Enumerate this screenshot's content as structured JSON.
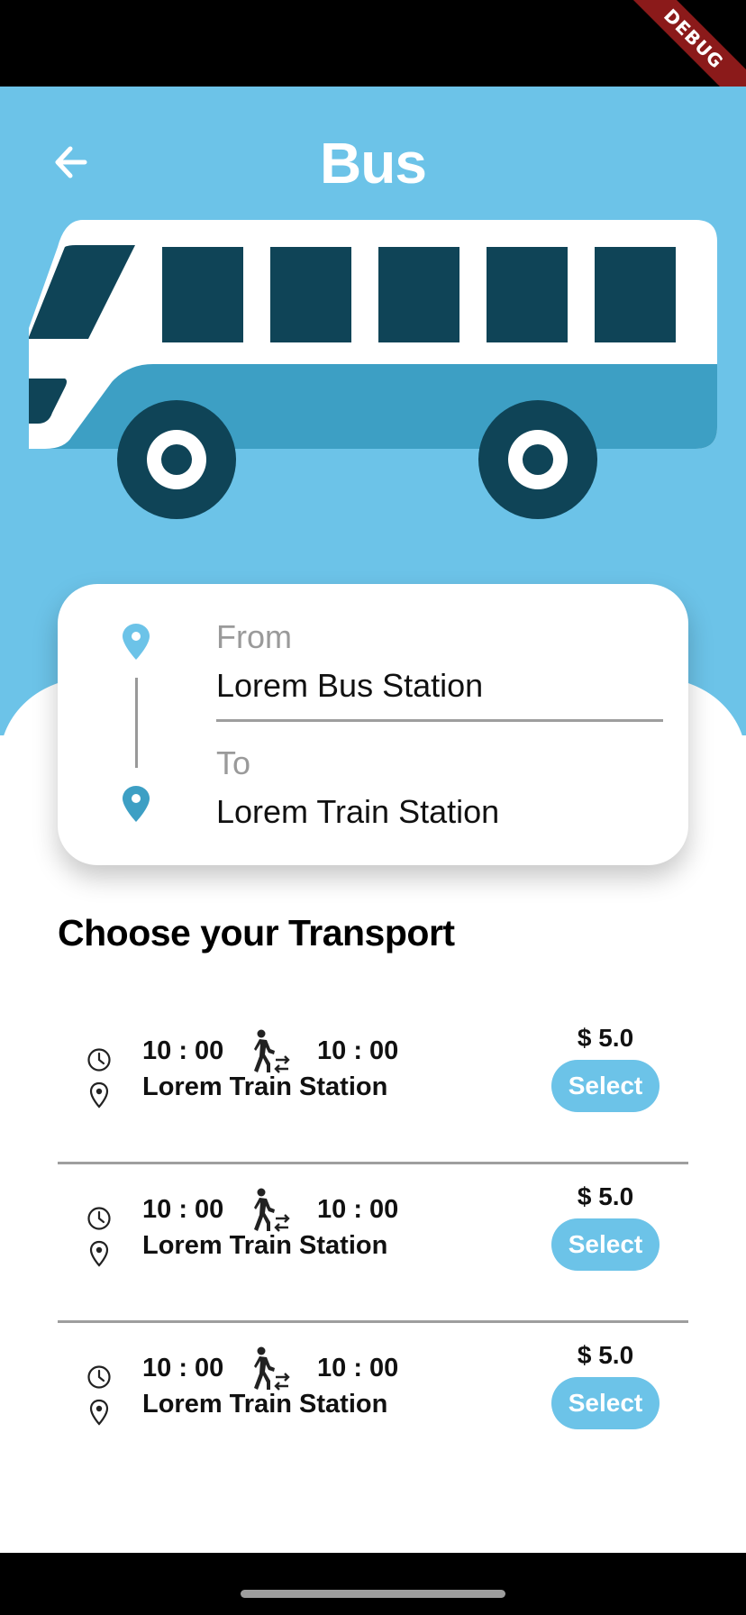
{
  "status_bar": {
    "debug_label": "DEBUG"
  },
  "header": {
    "title": "Bus",
    "back_icon": "arrow-left-icon"
  },
  "colors": {
    "primary": "#6cc3e8",
    "dark": "#0f4457",
    "mid": "#3d9fc4",
    "white": "#ffffff"
  },
  "route": {
    "from_label": "From",
    "from_value": "Lorem Bus Station",
    "to_label": "To",
    "to_value": "Lorem Train Station"
  },
  "section_title": "Choose your Transport",
  "transports": [
    {
      "depart": "10 : 00",
      "arrive": "10 : 00",
      "station": "Lorem Train Station",
      "price": "$ 5.0",
      "select_label": "Select"
    },
    {
      "depart": "10 : 00",
      "arrive": "10 : 00",
      "station": "Lorem Train Station",
      "price": "$ 5.0",
      "select_label": "Select"
    },
    {
      "depart": "10 : 00",
      "arrive": "10 : 00",
      "station": "Lorem Train Station",
      "price": "$ 5.0",
      "select_label": "Select"
    }
  ]
}
